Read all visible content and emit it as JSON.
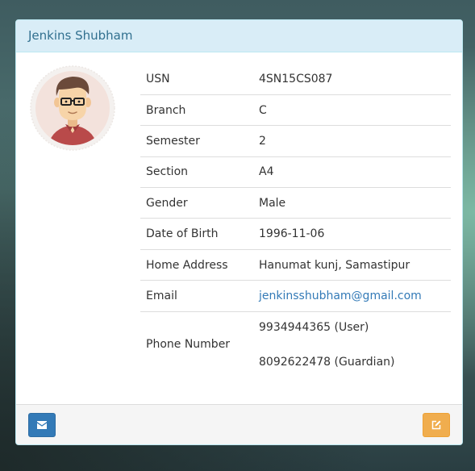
{
  "profile": {
    "name": "Jenkins Shubham",
    "avatar_icon": "user-avatar-icon"
  },
  "details": [
    {
      "label": "USN",
      "value": "4SN15CS087"
    },
    {
      "label": "Branch",
      "value": "C"
    },
    {
      "label": "Semester",
      "value": "2"
    },
    {
      "label": "Section",
      "value": "A4"
    },
    {
      "label": "Gender",
      "value": "Male"
    },
    {
      "label": "Date of Birth",
      "value": "1996-11-06"
    },
    {
      "label": "Home Address",
      "value": "Hanumat kunj, Samastipur"
    },
    {
      "label": "Email",
      "value": "jenkinsshubham@gmail.com"
    }
  ],
  "phone": {
    "label": "Phone Number",
    "user": "9934944365 (User)",
    "guardian": "8092622478 (Guardian)"
  },
  "footer": {
    "mail_icon": "envelope-icon",
    "edit_icon": "edit-icon"
  },
  "colors": {
    "heading_bg": "#d9edf7",
    "heading_text": "#31708f",
    "primary_button": "#337ab7",
    "warning_button": "#f0ad4e",
    "link": "#337ab7"
  }
}
